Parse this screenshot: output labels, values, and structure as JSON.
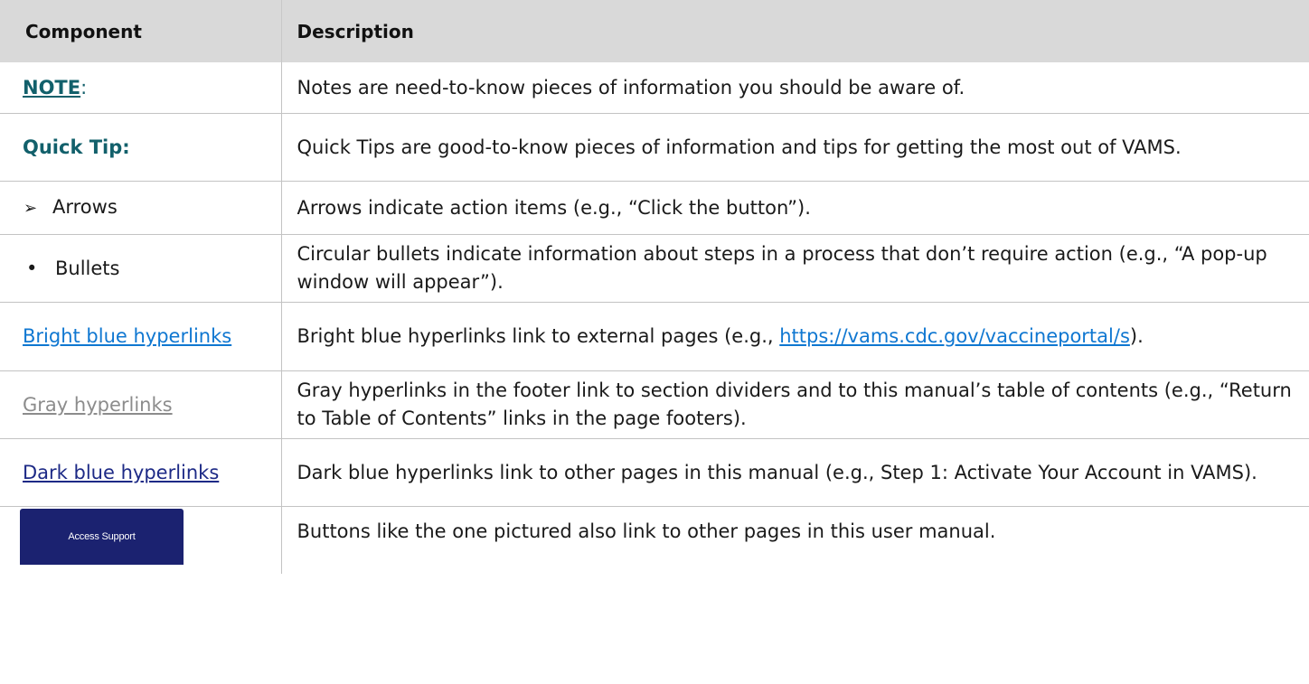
{
  "header": {
    "component": "Component",
    "description": "Description"
  },
  "rows": {
    "note": {
      "label": "NOTE",
      "colon": ":",
      "description": "Notes are need-to-know pieces of information you should be aware of."
    },
    "quick_tip": {
      "label": "Quick Tip:",
      "description": "Quick Tips are good-to-know pieces of information and tips for getting the most out of VAMS."
    },
    "arrows": {
      "glyph": "➢",
      "label": "Arrows",
      "description": "Arrows indicate action items (e.g., “Click the button”)."
    },
    "bullets": {
      "glyph": "•",
      "label": "Bullets",
      "description": "Circular bullets indicate information about steps in a process that don’t require action (e.g., “A pop-up window will appear”)."
    },
    "bright_blue": {
      "label": "Bright blue hyperlinks",
      "description_before": "Bright blue hyperlinks link to external pages (e.g., ",
      "url": "https://vams.cdc.gov/vaccineportal/s",
      "description_after": ")."
    },
    "gray": {
      "label": "Gray hyperlinks",
      "description": "Gray hyperlinks in the footer link to section dividers and to this manual’s table of contents (e.g., “Return to Table of Contents” links in the page footers)."
    },
    "dark_blue": {
      "label": "Dark blue hyperlinks",
      "description": "Dark blue hyperlinks link to other pages in this manual (e.g., Step 1: Activate Your Account in VAMS)."
    },
    "button": {
      "button_label": "Access Support",
      "description": "Buttons like the one pictured also link to other pages in this user manual."
    }
  },
  "colors": {
    "header_bg": "#d9d9d9",
    "teal": "#12606b",
    "bright_blue": "#0f77d1",
    "gray_link": "#8c8c8c",
    "dark_blue": "#1d2a86",
    "button_bg": "#1b2270"
  }
}
